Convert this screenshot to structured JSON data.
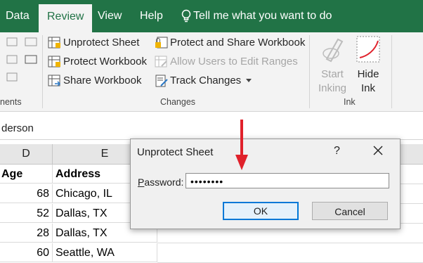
{
  "tabs": {
    "data": "Data",
    "review": "Review",
    "view": "View",
    "help": "Help",
    "tell_me": "Tell me what you want to do"
  },
  "ribbon": {
    "protect": {
      "unprotect_sheet": "Unprotect Sheet",
      "protect_workbook": "Protect Workbook",
      "share_workbook": "Share Workbook",
      "protect_and_share": "Protect and Share Workbook",
      "allow_users": "Allow Users to Edit Ranges",
      "track_changes": "Track Changes"
    },
    "changes_label": "Changes",
    "ink": {
      "start_inking_1": "Start",
      "start_inking_2": "Inking",
      "hide_ink_1": "Hide",
      "hide_ink_2": "Ink",
      "label": "Ink"
    },
    "comments_label_partial": "nents"
  },
  "formula_bar": {
    "value_partial": "derson"
  },
  "grid": {
    "columns": [
      "D",
      "E"
    ],
    "headers": {
      "age": "Age",
      "address": "Address"
    },
    "rows": [
      {
        "age": "68",
        "address": "Chicago, IL"
      },
      {
        "age": "52",
        "address": "Dallas, TX"
      },
      {
        "age": "28",
        "address": "Dallas, TX"
      },
      {
        "age": "60",
        "address": "Seattle, WA"
      }
    ]
  },
  "dialog": {
    "title": "Unprotect Sheet",
    "help": "?",
    "password_label_p": "P",
    "password_label_rest": "assword:",
    "password_value": "••••••••",
    "ok": "OK",
    "cancel": "Cancel"
  },
  "colors": {
    "excel_green": "#217346",
    "annotation_red": "#e0212b",
    "ok_focus": "#0078d7"
  }
}
